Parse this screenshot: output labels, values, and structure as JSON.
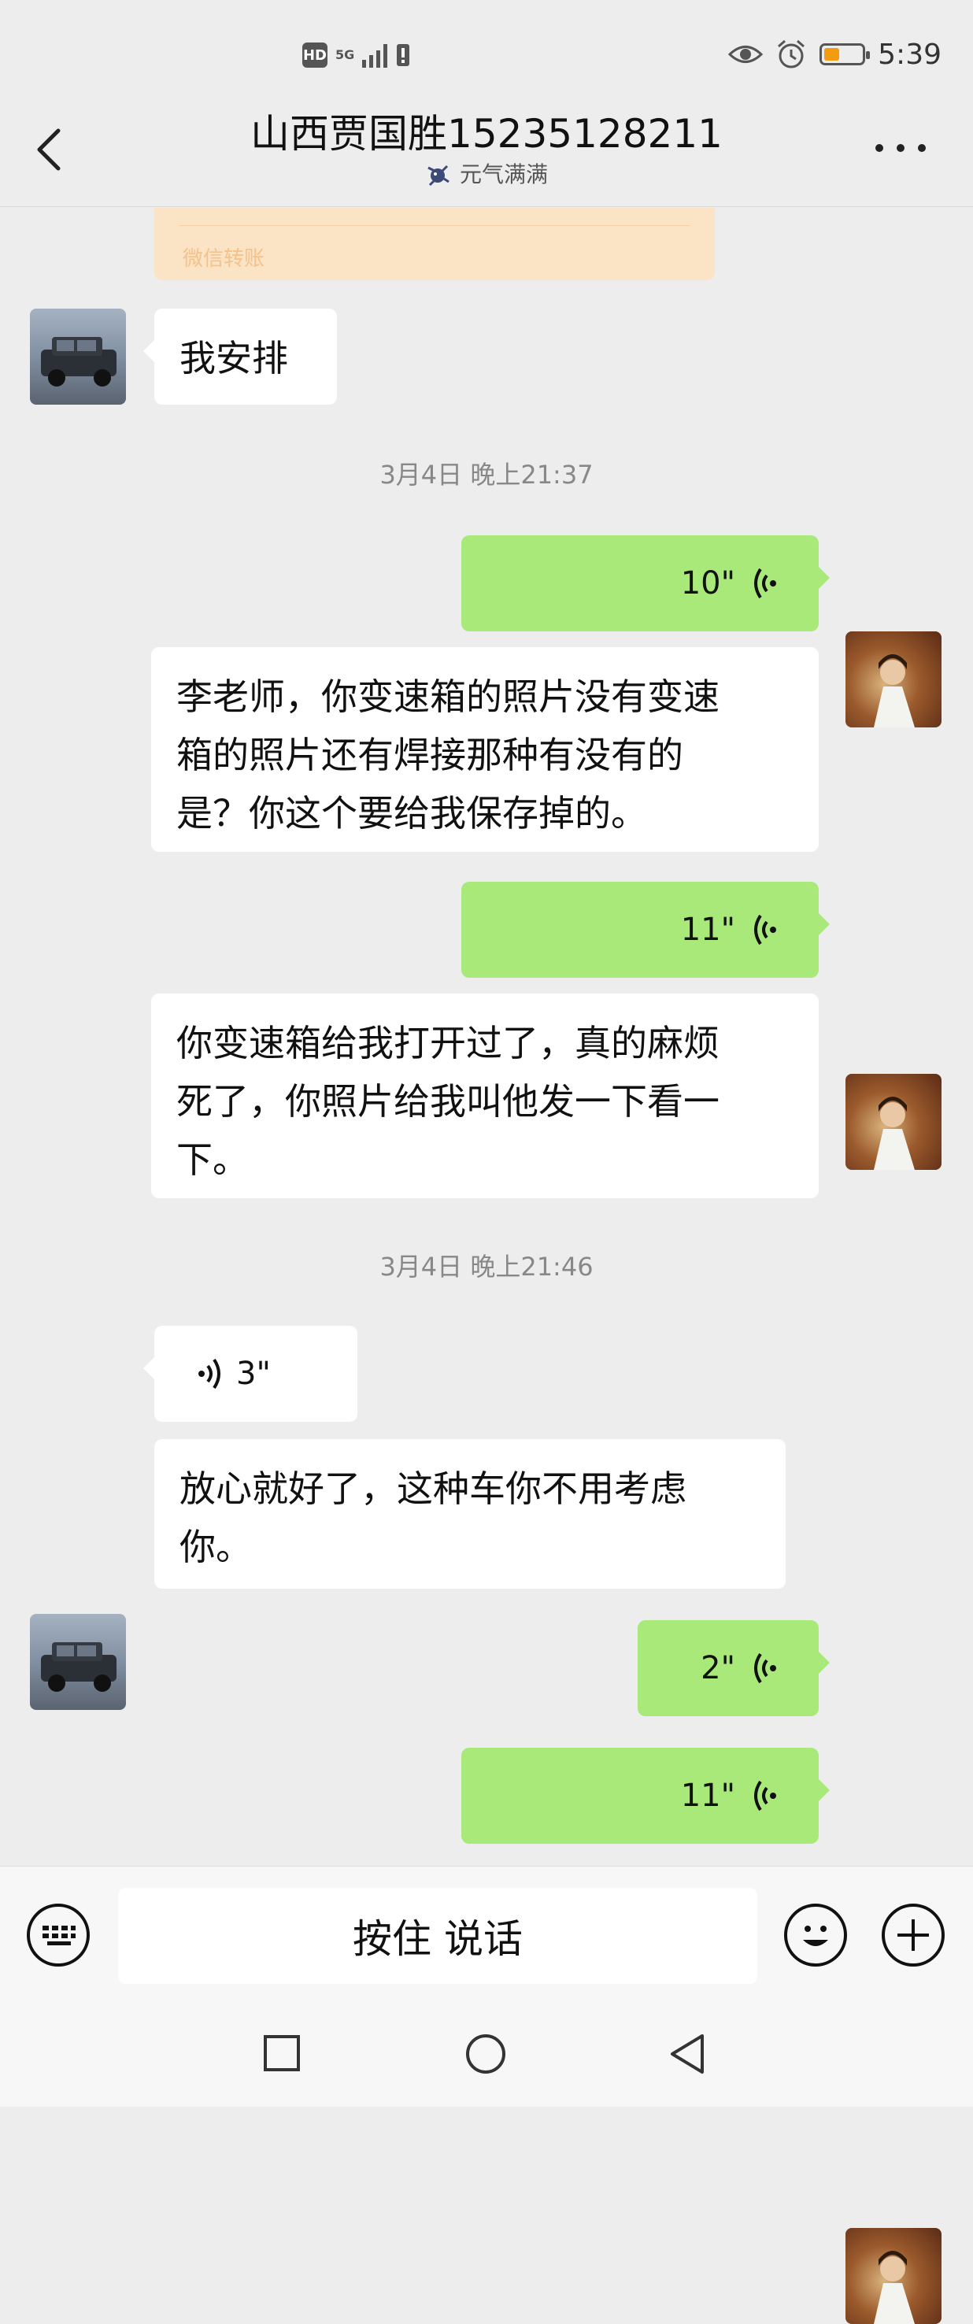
{
  "status_bar": {
    "hd": "HD",
    "network": "5G",
    "time": "5:39",
    "battery_percent": 40
  },
  "header": {
    "title": "山西贾国胜15235128211",
    "subtitle": "元气满满"
  },
  "transfer": {
    "label": "微信转账"
  },
  "messages": [
    {
      "side": "left",
      "type": "text",
      "text": "我安排"
    },
    {
      "type": "timestamp",
      "text": "3月4日 晚上21:37"
    },
    {
      "side": "right",
      "type": "voice",
      "duration": "10\""
    },
    {
      "side": "right",
      "type": "transcript",
      "lines": [
        "李老师，你变速箱的照片没有变速",
        "箱的照片还有焊接那种有没有的",
        "是？你这个要给我保存掉的。"
      ]
    },
    {
      "side": "right",
      "type": "voice",
      "duration": "11\""
    },
    {
      "side": "right",
      "type": "transcript",
      "lines": [
        "你变速箱给我打开过了，真的麻烦",
        "死了，你照片给我叫他发一下看一",
        "下。"
      ]
    },
    {
      "type": "timestamp",
      "text": "3月4日 晚上21:46"
    },
    {
      "side": "left",
      "type": "voice",
      "duration": "3\""
    },
    {
      "side": "left",
      "type": "transcript",
      "lines": [
        "放心就好了，这种车你不用考虑",
        "你。"
      ]
    },
    {
      "side": "right",
      "type": "voice",
      "duration": "2\""
    },
    {
      "side": "right",
      "type": "voice",
      "duration": "11\""
    }
  ],
  "input_bar": {
    "talk_label": "按住 说话"
  },
  "icons": {
    "back": "back-arrow-icon",
    "more": "more-icon",
    "keyboard": "keyboard-icon",
    "emoji": "emoji-icon",
    "plus": "plus-icon",
    "recent_apps": "square-nav-icon",
    "home": "circle-nav-icon",
    "back_nav": "triangle-nav-icon"
  },
  "colors": {
    "background": "#ededed",
    "sent_bubble": "#a9e97a",
    "received_bubble": "#ffffff",
    "transfer_card": "#fbe3c6",
    "battery": "#f39c12"
  }
}
